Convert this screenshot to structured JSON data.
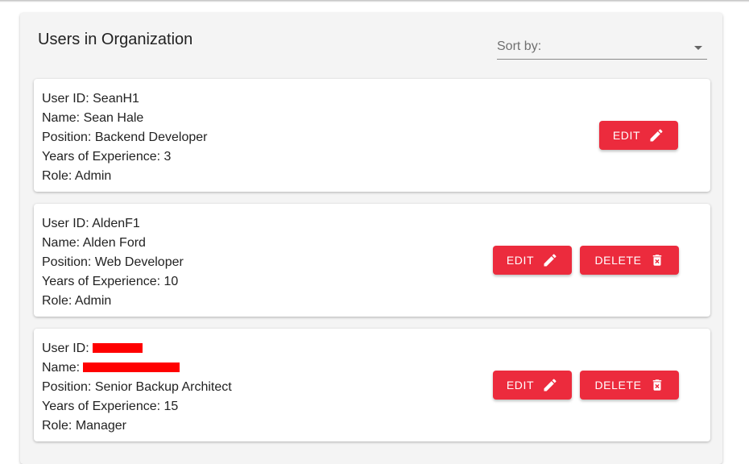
{
  "panel": {
    "title": "Users in Organization",
    "sort": {
      "label": "Sort by:",
      "value": ""
    }
  },
  "users": [
    {
      "user_id_label": "User ID:",
      "user_id": "SeanH1",
      "name_label": "Name:",
      "name": "Sean Hale",
      "position_label": "Position:",
      "position": "Backend Developer",
      "experience_label": "Years of Experience:",
      "experience": "3",
      "role_label": "Role:",
      "role": "Admin",
      "edit_label": "EDIT"
    },
    {
      "user_id_label": "User ID:",
      "user_id": "AldenF1",
      "name_label": "Name:",
      "name": "Alden Ford",
      "position_label": "Position:",
      "position": "Web Developer",
      "experience_label": "Years of Experience:",
      "experience": "10",
      "role_label": "Role:",
      "role": "Admin",
      "edit_label": "EDIT",
      "delete_label": "DELETE"
    },
    {
      "user_id_label": "User ID:",
      "name_label": "Name:",
      "position_label": "Position:",
      "position": "Senior Backup Architect",
      "experience_label": "Years of Experience:",
      "experience": "15",
      "role_label": "Role:",
      "role": "Manager",
      "edit_label": "EDIT",
      "delete_label": "DELETE"
    }
  ],
  "icons": {
    "edit": "pencil-icon",
    "delete": "trash-icon"
  },
  "colors": {
    "accent": "#ec2b3d",
    "panel_bg": "#f4f4f4",
    "card_bg": "#ffffff",
    "redaction": "#ff0000"
  }
}
